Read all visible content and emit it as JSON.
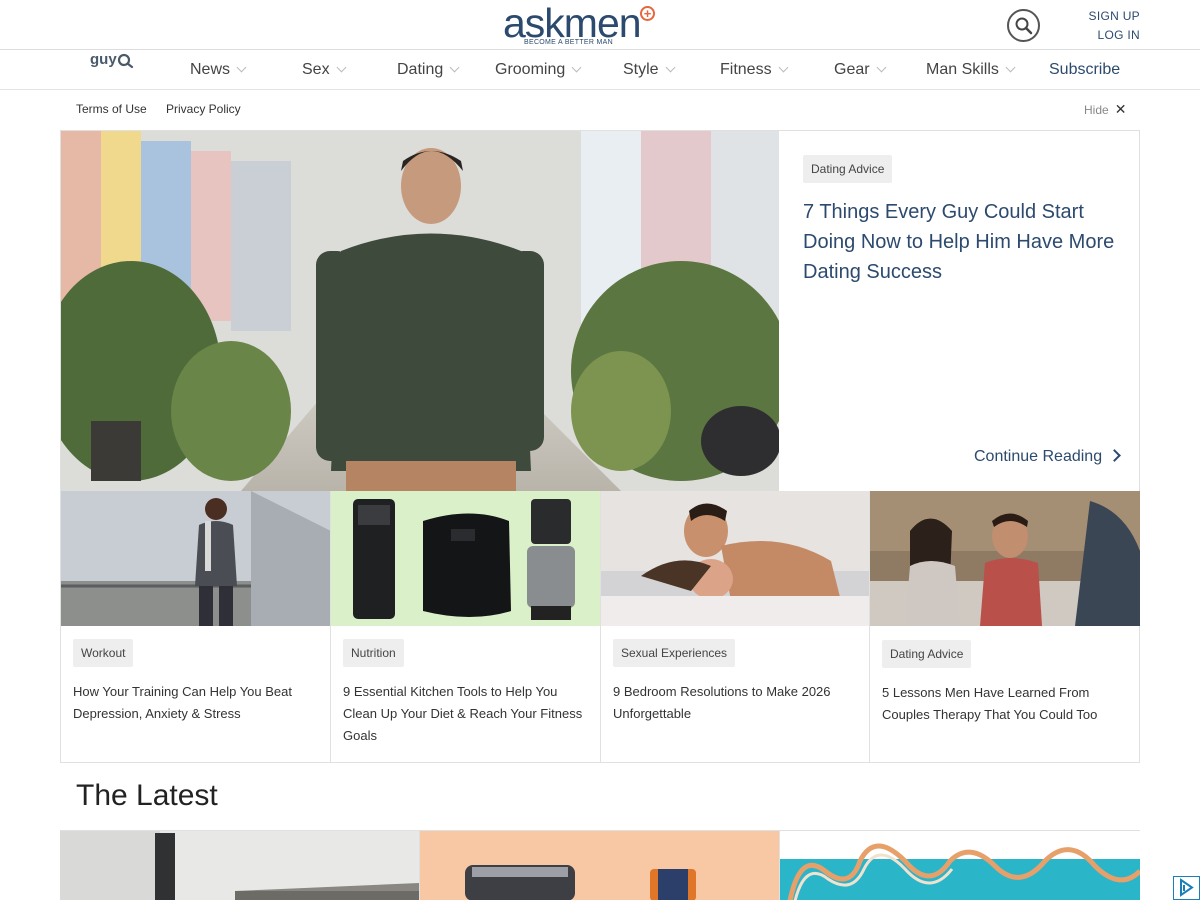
{
  "brand": {
    "logo_text": "askmen",
    "tagline": "BECOME A BETTER MAN",
    "accent_color": "#e8663d",
    "primary_color": "#2c4a6e"
  },
  "header": {
    "search_icon": "search-icon",
    "sign_up": "SIGN UP",
    "log_in": "LOG IN"
  },
  "nav": {
    "guy_label": "guy",
    "items": [
      "News",
      "Sex",
      "Dating",
      "Grooming",
      "Style",
      "Fitness",
      "Gear",
      "Man Skills"
    ],
    "subscribe": "Subscribe"
  },
  "subbar": {
    "terms": "Terms of Use",
    "privacy": "Privacy Policy",
    "hide": "Hide",
    "close_icon": "close-icon"
  },
  "hero": {
    "tag": "Dating Advice",
    "title": "7 Things Every Guy Could Start Doing Now to Help Him Have More Dating Success",
    "cta": "Continue Reading"
  },
  "cards": [
    {
      "tag": "Workout",
      "title": "How Your Training Can Help You Beat Depression, Anxiety & Stress"
    },
    {
      "tag": "Nutrition",
      "title": "9 Essential Kitchen Tools to Help You Clean Up Your Diet & Reach Your Fitness Goals"
    },
    {
      "tag": "Sexual Experiences",
      "title": "9 Bedroom Resolutions to Make 2026 Unforgettable"
    },
    {
      "tag": "Dating Advice",
      "title": "5 Lessons Men Have Learned From Couples Therapy That You Could Too"
    }
  ],
  "latest": {
    "heading": "The Latest"
  }
}
